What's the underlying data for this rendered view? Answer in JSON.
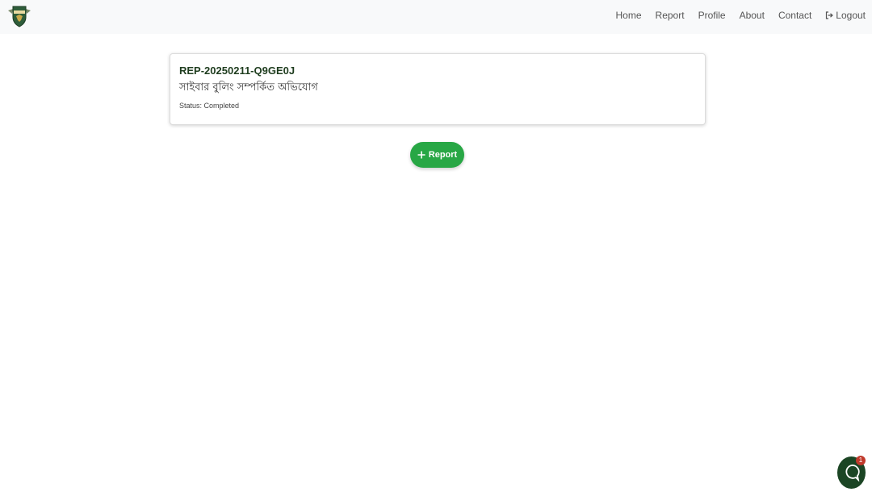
{
  "header": {
    "logo_icon": "ncw-shield-logo-icon",
    "nav": [
      {
        "label": "Home"
      },
      {
        "label": "Report"
      },
      {
        "label": "Profile"
      },
      {
        "label": "About"
      },
      {
        "label": "Contact"
      },
      {
        "label": "Logout",
        "icon": "logout-icon"
      }
    ]
  },
  "report_card": {
    "id": "REP-20250211-Q9GE0J",
    "title": "সাইবার বুলিং সম্পর্কিত অভিযোগ",
    "status": "Status: Completed"
  },
  "add_report_button": {
    "label": "Report",
    "icon": "plus-icon"
  },
  "chat_widget": {
    "icon": "chat-bubble-icon",
    "badge": "1"
  },
  "colors": {
    "accent": "#28a745",
    "navbar_bg": "#f8f9fa",
    "chat_bg": "#1b4524",
    "badge": "#c0392b"
  }
}
